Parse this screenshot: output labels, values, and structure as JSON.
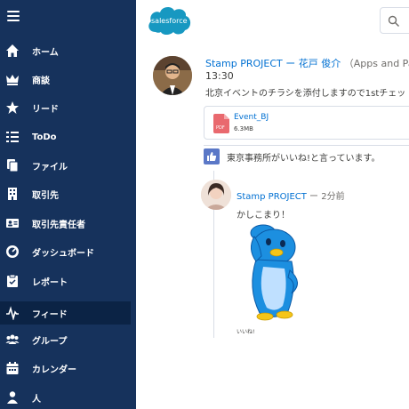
{
  "sidebar": {
    "items": [
      {
        "label": "ホーム",
        "icon": "home-icon"
      },
      {
        "label": "商談",
        "icon": "crown-icon"
      },
      {
        "label": "リード",
        "icon": "star-icon"
      },
      {
        "label": "ToDo",
        "icon": "task-list-icon"
      },
      {
        "label": "ファイル",
        "icon": "file-icon"
      },
      {
        "label": "取引先",
        "icon": "building-icon"
      },
      {
        "label": "取引先責任者",
        "icon": "contact-card-icon"
      },
      {
        "label": "ダッシュボード",
        "icon": "dashboard-gauge-icon"
      },
      {
        "label": "レポート",
        "icon": "clipboard-icon"
      },
      {
        "label": "フィード",
        "icon": "feed-pulse-icon",
        "active": true
      },
      {
        "label": "グループ",
        "icon": "group-icon"
      },
      {
        "label": "カレンダー",
        "icon": "calendar-icon"
      },
      {
        "label": "人",
        "icon": "person-icon"
      }
    ]
  },
  "header": {
    "logo_text": "salesforce"
  },
  "post": {
    "author": "Stamp PROJECT",
    "separator": "ー",
    "target": "花戸 俊介",
    "app": "（Apps and Par",
    "time": "13:30",
    "body": "北京イベントのチラシを添付しますので1stチェッ",
    "attachment": {
      "name": "Event_BJ",
      "size": "6.3MB",
      "type_label": "PDF"
    },
    "like_text": "東京事務所がいいね!と言っています。"
  },
  "comment": {
    "author": "Stamp PROJECT",
    "time": " ー 2分前",
    "body": "かしこまり！",
    "sticker_caption": "いいね!"
  },
  "colors": {
    "sidebar_bg": "#16325c",
    "sidebar_active": "#0b2345",
    "link": "#0070d2",
    "logo_blue": "#1798c1"
  }
}
